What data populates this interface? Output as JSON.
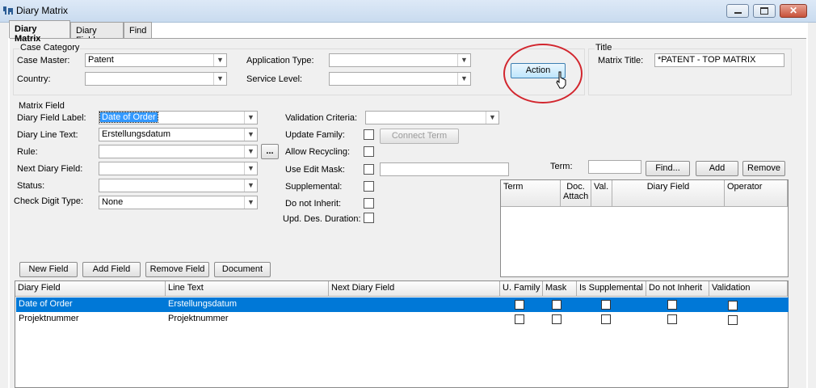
{
  "window": {
    "title": "Diary Matrix"
  },
  "tabs": [
    {
      "label": "Diary Matrix"
    },
    {
      "label": "Diary Field"
    },
    {
      "label": "Find"
    }
  ],
  "case_category": {
    "group_label": "Case Category",
    "case_master_label": "Case Master:",
    "case_master_value": "Patent",
    "country_label": "Country:",
    "application_type_label": "Application Type:",
    "service_level_label": "Service Level:"
  },
  "action_button": "Action",
  "title_group": {
    "group_label": "Title",
    "matrix_title_label": "Matrix Title:",
    "matrix_title_value": "*PATENT - TOP MATRIX"
  },
  "matrix_field": {
    "group_label": "Matrix Field",
    "diary_field_label_label": "Diary Field Label:",
    "diary_field_label_value": "Date of Order",
    "diary_line_text_label": "Diary Line Text:",
    "diary_line_text_value": "Erstellungsdatum",
    "rule_label": "Rule:",
    "rule_button": "...",
    "next_diary_field_label": "Next Diary Field:",
    "status_label": "Status:",
    "check_digit_type_label": "Check Digit Type:",
    "check_digit_type_value": "None",
    "validation_criteria_label": "Validation Criteria:",
    "update_family_label": "Update Family:",
    "connect_term_button": "Connect Term",
    "allow_recycling_label": "Allow Recycling:",
    "use_edit_mask_label": "Use Edit Mask:",
    "supplemental_label": "Supplemental:",
    "do_not_inherit_label": "Do not Inherit:",
    "upd_des_duration_label": "Upd. Des. Duration:"
  },
  "term": {
    "label": "Term:",
    "find_button": "Find...",
    "add_button": "Add",
    "remove_button": "Remove",
    "columns": [
      "Term",
      "Doc. Attach",
      "Val.",
      "Diary Field",
      "Operator"
    ]
  },
  "buttons": {
    "new_field": "New Field",
    "add_field": "Add Field",
    "remove_field": "Remove Field",
    "document": "Document"
  },
  "grid": {
    "columns": [
      "Diary Field",
      "Line Text",
      "Next Diary Field",
      "U. Family",
      "Mask",
      "Is Supplemental",
      "Do not Inherit",
      "Validation"
    ],
    "rows": [
      {
        "diary_field": "Date of Order",
        "line_text": "Erstellungsdatum",
        "next_diary_field": ""
      },
      {
        "diary_field": "Projektnummer",
        "line_text": "Projektnummer",
        "next_diary_field": ""
      }
    ]
  }
}
